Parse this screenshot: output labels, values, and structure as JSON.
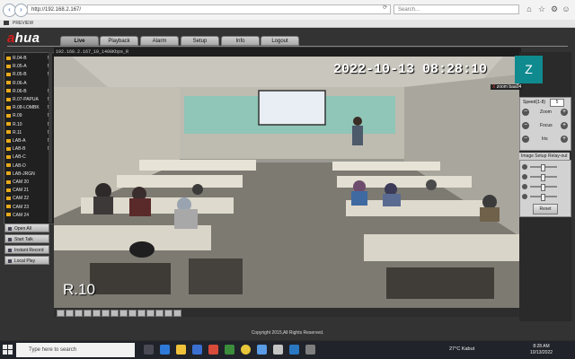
{
  "browser": {
    "address": "http://192.168.2.167/",
    "search_placeholder": "Search...",
    "tab_title": "PREVIEW"
  },
  "app": {
    "logo_prefix": "a",
    "logo_rest": "hua",
    "tabs": [
      "Live",
      "Playback",
      "Alarm",
      "Setup",
      "Info",
      "Logout"
    ],
    "active_tab": "Live",
    "footer": "Copyright 2015,All Rights Reserved."
  },
  "camera_list": [
    {
      "name": "R.04-B",
      "m": "M"
    },
    {
      "name": "R.05-A",
      "m": "M"
    },
    {
      "name": "R.05-B",
      "m": "M"
    },
    {
      "name": "R.06-A",
      "m": ""
    },
    {
      "name": "R.06-B",
      "m": "M"
    },
    {
      "name": "R.07-PAPUA",
      "m": "M"
    },
    {
      "name": "R.08-LOMBK",
      "m": "M"
    },
    {
      "name": "R.09",
      "m": "M"
    },
    {
      "name": "R.10",
      "m": "M"
    },
    {
      "name": "R.11",
      "m": "M"
    },
    {
      "name": "LAB-A",
      "m": "M"
    },
    {
      "name": "LAB-B",
      "m": "M"
    },
    {
      "name": "LAB-C",
      "m": ""
    },
    {
      "name": "LAB-D",
      "m": ""
    },
    {
      "name": "LAB-JRGN",
      "m": ""
    },
    {
      "name": "CAM 20",
      "m": ""
    },
    {
      "name": "CAM 21",
      "m": ""
    },
    {
      "name": "CAM 22",
      "m": ""
    },
    {
      "name": "CAM 23",
      "m": ""
    },
    {
      "name": "CAM 24",
      "m": ""
    }
  ],
  "left_buttons": [
    "Open All",
    "Start Talk",
    "Instant Record",
    "Local Play"
  ],
  "video": {
    "header": "192.168.2.167_10_1408Kbps_R",
    "osd_time": "2022-10-13  08:28:10",
    "osd_label": "R.10"
  },
  "zoom": {
    "tile_letter": "Z",
    "caption": "zoom baa04",
    "close": "X"
  },
  "ptz": {
    "speed_label": "Speed(1-8)",
    "speed_value": "5",
    "zoom_label": "Zoom",
    "focus_label": "Focus",
    "iris_label": "Iris"
  },
  "image_setup": {
    "tab_label": "Image Setup",
    "tab2_label": "Relay-out",
    "reset_label": "Reset",
    "sliders": [
      0.45,
      0.45,
      0.45,
      0.45
    ]
  },
  "taskbar": {
    "search_placeholder": "Type here to search",
    "weather": "27°C  Kabut",
    "time": "8:28 AM",
    "date": "10/13/2022"
  }
}
